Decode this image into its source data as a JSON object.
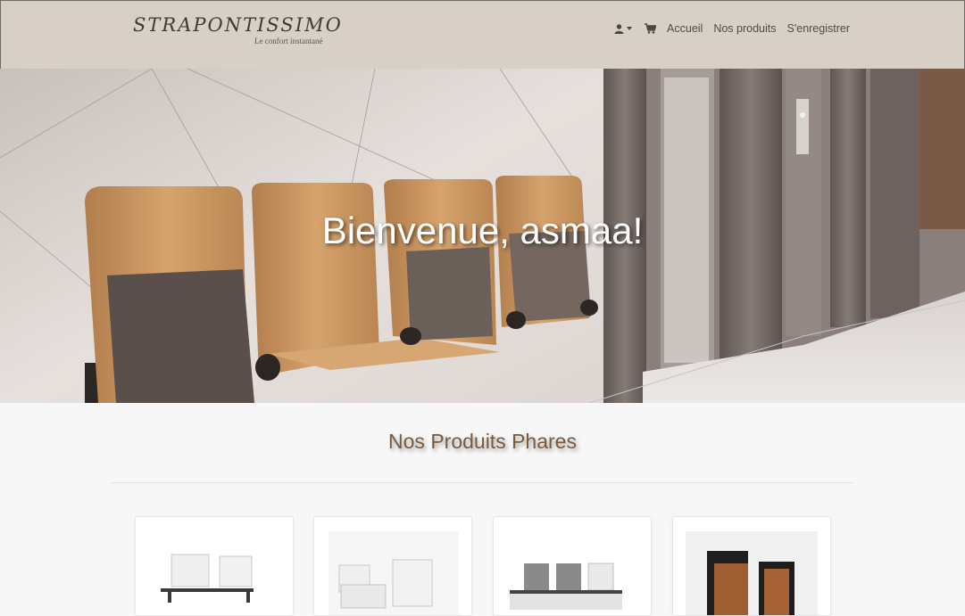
{
  "brand": {
    "title": "STRAPONTISSIMO",
    "tagline": "Le confort instantané"
  },
  "nav": {
    "user_icon": "user-icon",
    "cart_icon": "shopping-cart-icon",
    "links": [
      {
        "label": "Accueil"
      },
      {
        "label": "Nos produits"
      },
      {
        "label": "S'enregistrer"
      }
    ]
  },
  "hero": {
    "title": "Bienvenue, asmaa!"
  },
  "featured": {
    "title": "Nos Produits Phares",
    "products": [
      {
        "image": "white-flip-seats-on-beam"
      },
      {
        "image": "white-folding-seats"
      },
      {
        "image": "grey-mesh-seats-on-beam"
      },
      {
        "image": "black-and-wood-folding-seat"
      }
    ]
  },
  "colors": {
    "navbar": "#d8cfc6",
    "heading": "#7a5a3c",
    "background": "#f7f7f7"
  }
}
